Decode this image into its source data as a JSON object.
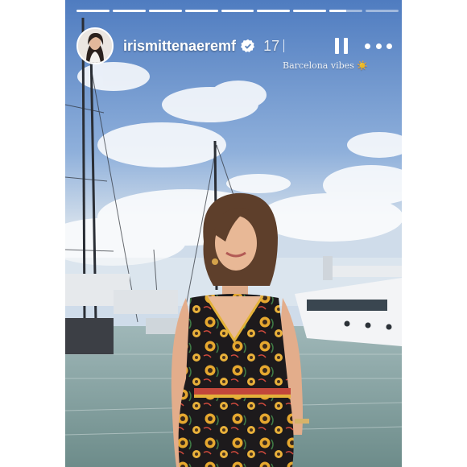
{
  "story": {
    "username": "irismittenaeremf",
    "time_ago": "17",
    "caption": "Barcelona vibes ☀️",
    "progress": {
      "segments": 9,
      "completed": 7,
      "current_fill": 0.5
    },
    "icons": {
      "verified": "verified-badge-icon",
      "pause": "pause-icon",
      "more": "more-options-icon"
    },
    "colors": {
      "sky": "#6b93c9",
      "water": "#6f8f8e",
      "dress": "#1d1a1c",
      "dress_pattern": "#e0a531"
    }
  }
}
